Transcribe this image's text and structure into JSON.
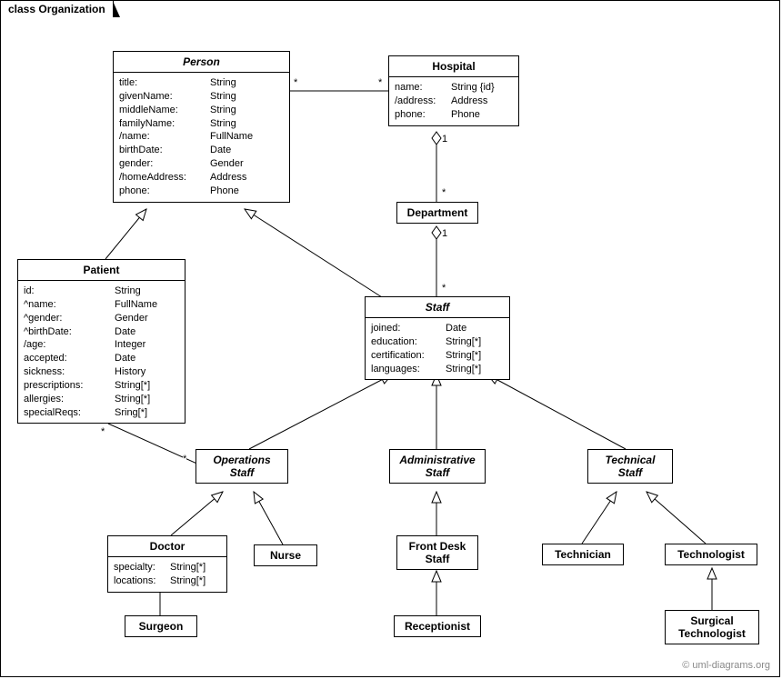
{
  "frame": {
    "title": "class Organization"
  },
  "classes": {
    "person": {
      "name": "Person",
      "abstract": true,
      "attrs": [
        [
          "title:",
          "String"
        ],
        [
          "givenName:",
          "String"
        ],
        [
          "middleName:",
          "String"
        ],
        [
          "familyName:",
          "String"
        ],
        [
          "/name:",
          "FullName"
        ],
        [
          "birthDate:",
          "Date"
        ],
        [
          "gender:",
          "Gender"
        ],
        [
          "/homeAddress:",
          "Address"
        ],
        [
          "phone:",
          "Phone"
        ]
      ]
    },
    "hospital": {
      "name": "Hospital",
      "attrs": [
        [
          "name:",
          "String {id}"
        ],
        [
          "/address:",
          "Address"
        ],
        [
          "phone:",
          "Phone"
        ]
      ]
    },
    "department": {
      "name": "Department"
    },
    "patient": {
      "name": "Patient",
      "attrs": [
        [
          "id:",
          "String"
        ],
        [
          "^name:",
          "FullName"
        ],
        [
          "^gender:",
          "Gender"
        ],
        [
          "^birthDate:",
          "Date"
        ],
        [
          "/age:",
          "Integer"
        ],
        [
          "accepted:",
          "Date"
        ],
        [
          "sickness:",
          "History"
        ],
        [
          "prescriptions:",
          "String[*]"
        ],
        [
          "allergies:",
          "String[*]"
        ],
        [
          "specialReqs:",
          "Sring[*]"
        ]
      ]
    },
    "staff": {
      "name": "Staff",
      "abstract": true,
      "attrs": [
        [
          "joined:",
          "Date"
        ],
        [
          "education:",
          "String[*]"
        ],
        [
          "certification:",
          "String[*]"
        ],
        [
          "languages:",
          "String[*]"
        ]
      ]
    },
    "opsStaff": {
      "name": "Operations Staff",
      "abstract": true,
      "twoLine": [
        "Operations",
        "Staff"
      ]
    },
    "adminStaff": {
      "name": "Administrative Staff",
      "abstract": true,
      "twoLine": [
        "Administrative",
        "Staff"
      ]
    },
    "techStaff": {
      "name": "Technical Staff",
      "abstract": true,
      "twoLine": [
        "Technical",
        "Staff"
      ]
    },
    "doctor": {
      "name": "Doctor",
      "attrs": [
        [
          "specialty:",
          "String[*]"
        ],
        [
          "locations:",
          "String[*]"
        ]
      ]
    },
    "nurse": {
      "name": "Nurse"
    },
    "frontDesk": {
      "name": "Front Desk Staff",
      "twoLine": [
        "Front Desk",
        "Staff"
      ]
    },
    "receptionist": {
      "name": "Receptionist"
    },
    "technician": {
      "name": "Technician"
    },
    "technologist": {
      "name": "Technologist"
    },
    "surgTech": {
      "name": "Surgical Technologist",
      "twoLine": [
        "Surgical",
        "Technologist"
      ]
    },
    "surgeon": {
      "name": "Surgeon"
    }
  },
  "mults": {
    "personHospL": "*",
    "personHospR": "*",
    "hospDeptTop": "1",
    "hospDeptBot": "*",
    "deptStaffTop": "1",
    "deptStaffBot": "*",
    "patientOpsL": "*",
    "patientOpsR": "*"
  },
  "watermark": "© uml-diagrams.org"
}
